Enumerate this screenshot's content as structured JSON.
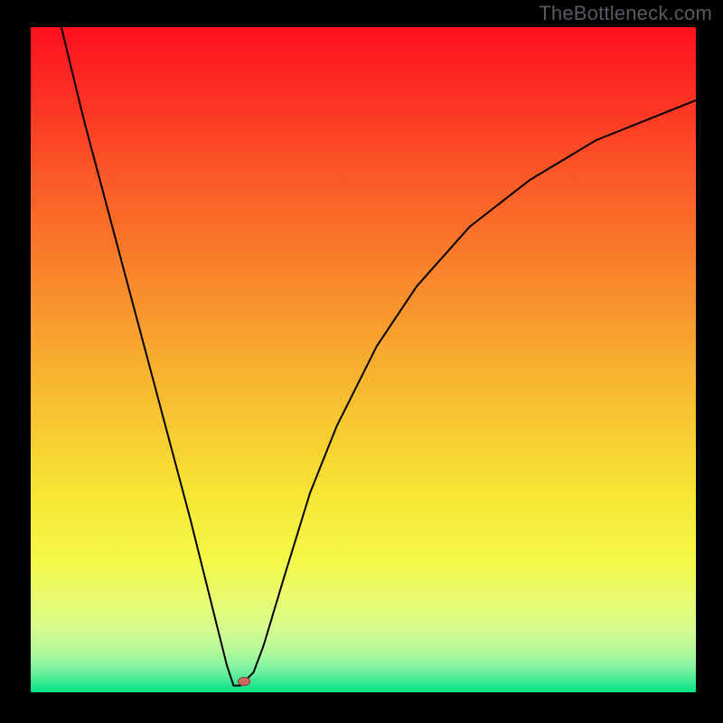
{
  "watermark": "TheBottleneck.com",
  "colors": {
    "black": "#000000",
    "stroke": "#000000",
    "marker_fill": "#cf6a60",
    "marker_stroke": "#7e3d36"
  },
  "gradient_stops": [
    {
      "offset": 0.0,
      "color": "#fd1020"
    },
    {
      "offset": 0.1,
      "color": "#fd2f23"
    },
    {
      "offset": 0.22,
      "color": "#fb5727"
    },
    {
      "offset": 0.34,
      "color": "#f97b2a"
    },
    {
      "offset": 0.46,
      "color": "#f8a02e"
    },
    {
      "offset": 0.58,
      "color": "#f7c431"
    },
    {
      "offset": 0.7,
      "color": "#f7e534"
    },
    {
      "offset": 0.8,
      "color": "#f4f847"
    },
    {
      "offset": 0.86,
      "color": "#e8fb6f"
    },
    {
      "offset": 0.905,
      "color": "#d6fb8e"
    },
    {
      "offset": 0.94,
      "color": "#b0f99c"
    },
    {
      "offset": 0.965,
      "color": "#7bf29e"
    },
    {
      "offset": 0.983,
      "color": "#3fe994"
    },
    {
      "offset": 1.0,
      "color": "#05e183"
    }
  ],
  "chart_data": {
    "type": "line",
    "title": "",
    "xlabel": "",
    "ylabel": "",
    "xlim": [
      0,
      100
    ],
    "ylim": [
      0,
      100
    ],
    "series": [
      {
        "name": "bottleneck-curve",
        "x": [
          4.6,
          8,
          12,
          16,
          20,
          24,
          27,
          29.5,
          30.5,
          31.5,
          33.5,
          35,
          38,
          42,
          46,
          52,
          58,
          66,
          75,
          85,
          95,
          100
        ],
        "y": [
          100,
          86,
          71,
          56,
          41,
          26,
          14,
          4,
          1,
          1,
          3,
          7,
          17,
          30,
          40,
          52,
          61,
          70,
          77,
          83,
          87,
          89
        ]
      }
    ],
    "annotations": [
      {
        "name": "optimum-marker",
        "x": 32,
        "y": 1.6
      }
    ]
  }
}
